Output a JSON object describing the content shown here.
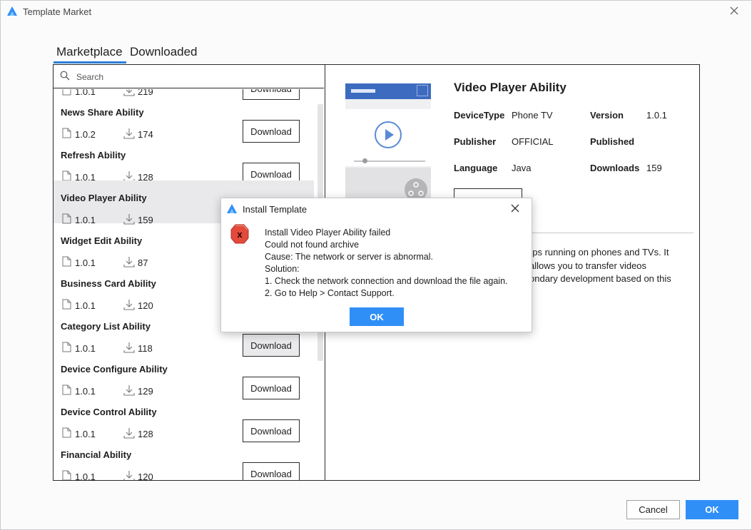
{
  "window": {
    "title": "Template Market"
  },
  "tabs": [
    {
      "label": "Marketplace",
      "active": true
    },
    {
      "label": "Downloaded",
      "active": false
    }
  ],
  "search": {
    "placeholder": "Search",
    "value": ""
  },
  "download_label": "Download",
  "templates": [
    {
      "name": "",
      "version": "1.0.1",
      "downloads": "219"
    },
    {
      "name": "News Share Ability",
      "version": "1.0.2",
      "downloads": "174"
    },
    {
      "name": "Refresh Ability",
      "version": "1.0.1",
      "downloads": "128"
    },
    {
      "name": "Video Player Ability",
      "version": "1.0.1",
      "downloads": "159",
      "selected": true
    },
    {
      "name": "Widget Edit Ability",
      "version": "1.0.1",
      "downloads": "87"
    },
    {
      "name": "Business Card Ability",
      "version": "1.0.1",
      "downloads": "120"
    },
    {
      "name": "Category List Ability",
      "version": "1.0.1",
      "downloads": "118"
    },
    {
      "name": "Device Configure Ability",
      "version": "1.0.1",
      "downloads": "129"
    },
    {
      "name": "Device Control Ability",
      "version": "1.0.1",
      "downloads": "128"
    },
    {
      "name": "Financial Ability",
      "version": "1.0.1",
      "downloads": "120"
    }
  ],
  "detail": {
    "title": "Video Player Ability",
    "fields": {
      "device_type_label": "DeviceType",
      "device_type": "Phone TV",
      "version_label": "Version",
      "version": "1.0.1",
      "publisher_label": "Publisher",
      "publisher": "OFFICIAL",
      "published_label": "Published",
      "published": "",
      "language_label": "Language",
      "language": "Java",
      "downloads_label": "Downloads",
      "downloads": "159"
    },
    "description_lines": [
      "pps running on phones and TVs. It",
      "allows you to transfer videos",
      "ondary development based on this"
    ]
  },
  "footer": {
    "cancel_label": "Cancel",
    "ok_label": "OK"
  },
  "dialog": {
    "title": "Install Template",
    "messages": [
      "Install Video Player Ability failed",
      "Could not found archive",
      "Cause: The network or server is abnormal.",
      "Solution:",
      "1. Check the network connection and download the file again.",
      "2. Go to Help > Contact Support."
    ],
    "ok_label": "OK",
    "error_icon_glyph": "x"
  },
  "colors": {
    "accent": "#2f8ff7",
    "tab_underline": "#2f7ed8",
    "selected_row": "#e9e9eb",
    "error_icon": "#e24a3b",
    "preview_header": "#3c6bc0"
  }
}
